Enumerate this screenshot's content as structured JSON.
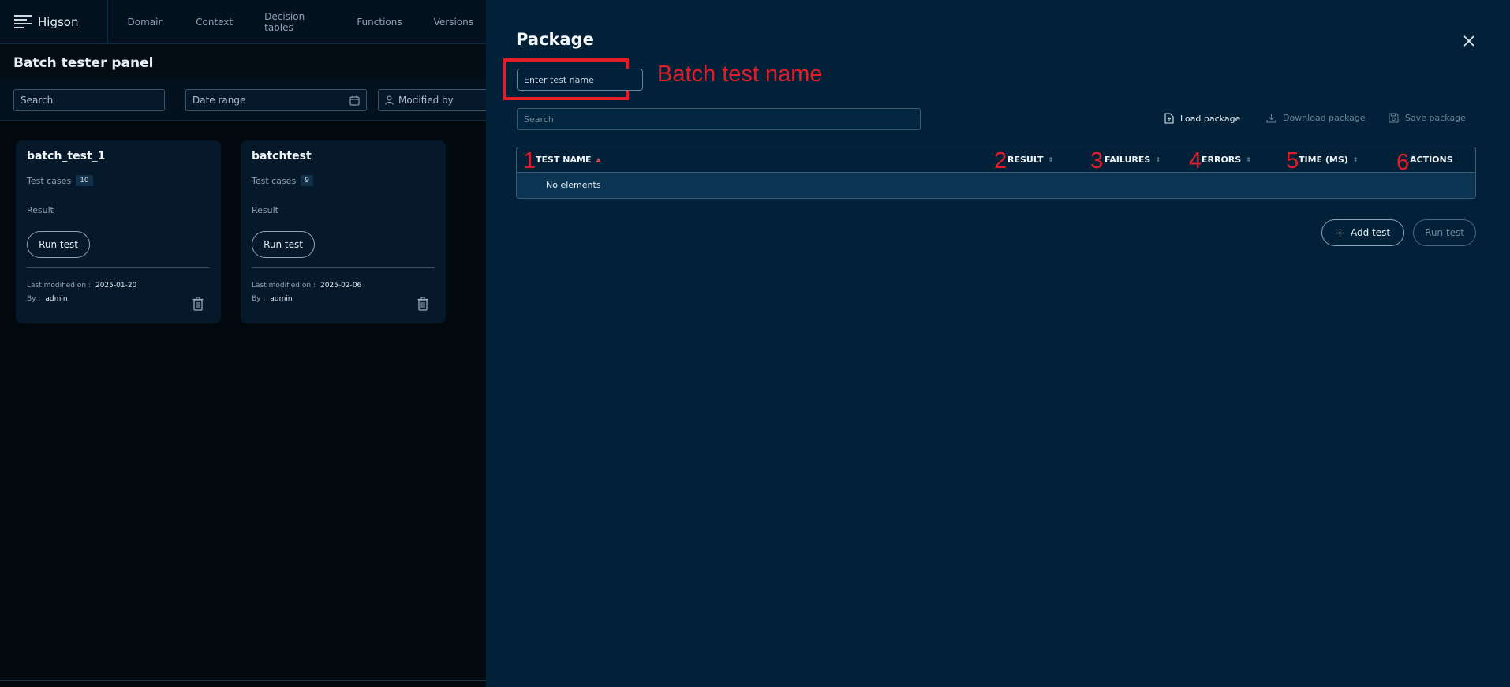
{
  "app": {
    "name": "Higson"
  },
  "nav": [
    "Domain",
    "Context",
    "Decision tables",
    "Functions",
    "Versions"
  ],
  "panel": {
    "title": "Batch tester panel",
    "search_placeholder": "Search",
    "date_range_placeholder": "Date range",
    "modified_by_placeholder": "Modified by"
  },
  "cards": [
    {
      "title": "batch_test_1",
      "test_cases_label": "Test cases",
      "test_cases_count": "10",
      "result_label": "Result",
      "run_label": "Run test",
      "modified_label": "Last modified on :",
      "modified_date": "2025-01-20",
      "by_label": "By :",
      "by_user": "admin"
    },
    {
      "title": "batchtest",
      "test_cases_label": "Test cases",
      "test_cases_count": "9",
      "result_label": "Result",
      "run_label": "Run test",
      "modified_label": "Last modified on :",
      "modified_date": "2025-02-06",
      "by_label": "By :",
      "by_user": "admin"
    }
  ],
  "drawer": {
    "title": "Package",
    "name_placeholder": "Enter test name",
    "annotation": "Batch test name",
    "search_placeholder": "Search",
    "load_label": "Load package",
    "download_label": "Download package",
    "save_label": "Save package",
    "columns": [
      {
        "num": "1",
        "label": "TEST NAME"
      },
      {
        "num": "2",
        "label": "RESULT"
      },
      {
        "num": "3",
        "label": "FAILURES"
      },
      {
        "num": "4",
        "label": "ERRORS"
      },
      {
        "num": "5",
        "label": "TIME (MS)"
      },
      {
        "num": "6",
        "label": "ACTIONS"
      }
    ],
    "empty_text": "No elements",
    "add_label": "Add test",
    "run_label": "Run test"
  },
  "colors": {
    "drawer_bg": "#012139",
    "annotation_red": "#e11d2a",
    "page_bg": "#020d16"
  }
}
